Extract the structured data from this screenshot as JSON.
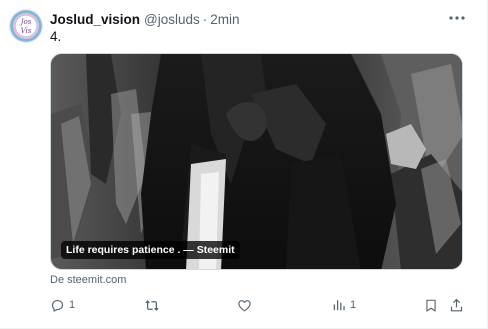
{
  "tweet": {
    "avatar_icon": "account-avatar-icon",
    "avatar_text": "Josh Vision",
    "display_name": "Joslud_vision",
    "handle": "@josluds",
    "separator": "·",
    "time": "2min",
    "text": "4.",
    "more_icon": "more-options-icon",
    "media": {
      "description_icon": "photo-image",
      "caption": "Life requires patience . — Steemit"
    },
    "source": "De steemit.com"
  },
  "actions": {
    "reply": {
      "icon": "reply-icon",
      "count": "1"
    },
    "retweet": {
      "icon": "retweet-icon",
      "count": ""
    },
    "like": {
      "icon": "like-icon",
      "count": ""
    },
    "views": {
      "icon": "views-icon",
      "count": "1"
    },
    "bookmark": {
      "icon": "bookmark-icon"
    },
    "share": {
      "icon": "share-icon"
    }
  },
  "colors": {
    "text_primary": "#0f1419",
    "text_secondary": "#536471",
    "border": "#eff3f4"
  }
}
